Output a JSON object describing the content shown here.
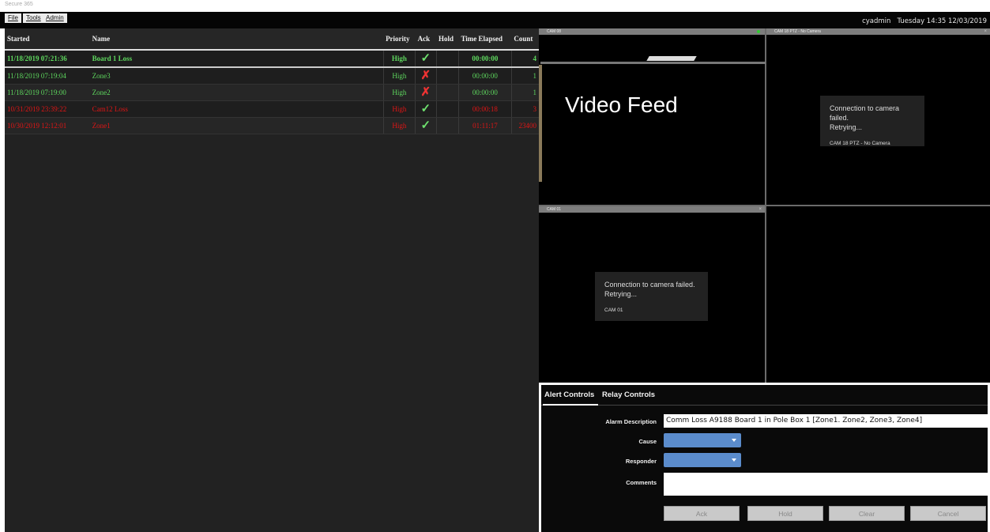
{
  "app": {
    "title": "Secure 365"
  },
  "menu": {
    "items": [
      "File",
      "Tools",
      "Admin"
    ]
  },
  "status": {
    "user": "cyadmin",
    "datetime": "Tuesday 14:35 12/03/2019"
  },
  "alarms": {
    "headers": [
      "Started",
      "Name",
      "Priority",
      "Ack",
      "Hold",
      "Time Elapsed",
      "Count"
    ],
    "rows": [
      {
        "started": "11/18/2019 07:21:36",
        "name": "Board 1 Loss",
        "priority": "High",
        "ack": "check",
        "hold": "",
        "elapsed": "00:00:00",
        "count": "4",
        "color": "green"
      },
      {
        "started": "11/18/2019 07:19:04",
        "name": "Zone3",
        "priority": "High",
        "ack": "x",
        "hold": "",
        "elapsed": "00:00:00",
        "count": "1",
        "color": "green"
      },
      {
        "started": "11/18/2019 07:19:00",
        "name": "Zone2",
        "priority": "High",
        "ack": "x",
        "hold": "",
        "elapsed": "00:00:00",
        "count": "1",
        "color": "green"
      },
      {
        "started": "10/31/2019 23:39:22",
        "name": "Cam12 Loss",
        "priority": "High",
        "ack": "check",
        "hold": "",
        "elapsed": "00:00:18",
        "count": "3",
        "color": "red"
      },
      {
        "started": "10/30/2019 12:12:01",
        "name": "Zone1",
        "priority": "High",
        "ack": "check",
        "hold": "",
        "elapsed": "01:11:17",
        "count": "23400",
        "color": "red"
      }
    ]
  },
  "video": {
    "overlay_label": "Video Feed",
    "cameras": [
      {
        "title": "CAM 08",
        "message": "",
        "message_line2": "",
        "cam_name": ""
      },
      {
        "title": "CAM 18  PTZ - No Camera",
        "message": "Connection to camera failed.",
        "message_line2": "Retrying...",
        "cam_name": "CAM 18  PTZ - No Camera"
      },
      {
        "title": "CAM 01",
        "message": "Connection to camera failed.",
        "message_line2": "Retrying...",
        "cam_name": "CAM 01"
      },
      {
        "title": "",
        "message": "",
        "message_line2": "",
        "cam_name": ""
      }
    ]
  },
  "controls": {
    "tabs": [
      "Alert Controls",
      "Relay Controls"
    ],
    "labels": {
      "description": "Alarm Description",
      "cause": "Cause",
      "responder": "Responder",
      "comments": "Comments"
    },
    "description_value": "Comm Loss A9188 Board 1 in Pole Box 1 [Zone1. Zone2, Zone3, Zone4]",
    "comments_value": "",
    "buttons": {
      "ack": "Ack",
      "hold": "Hold",
      "clear": "Clear",
      "cancel": "Cancel"
    },
    "dropdown_color": "#5b8ccc"
  },
  "colors": {
    "active_alarm": "#5ed85e",
    "stale_alarm": "#e01515",
    "ack_check": "#6ee06e",
    "ack_x": "#e33333"
  }
}
